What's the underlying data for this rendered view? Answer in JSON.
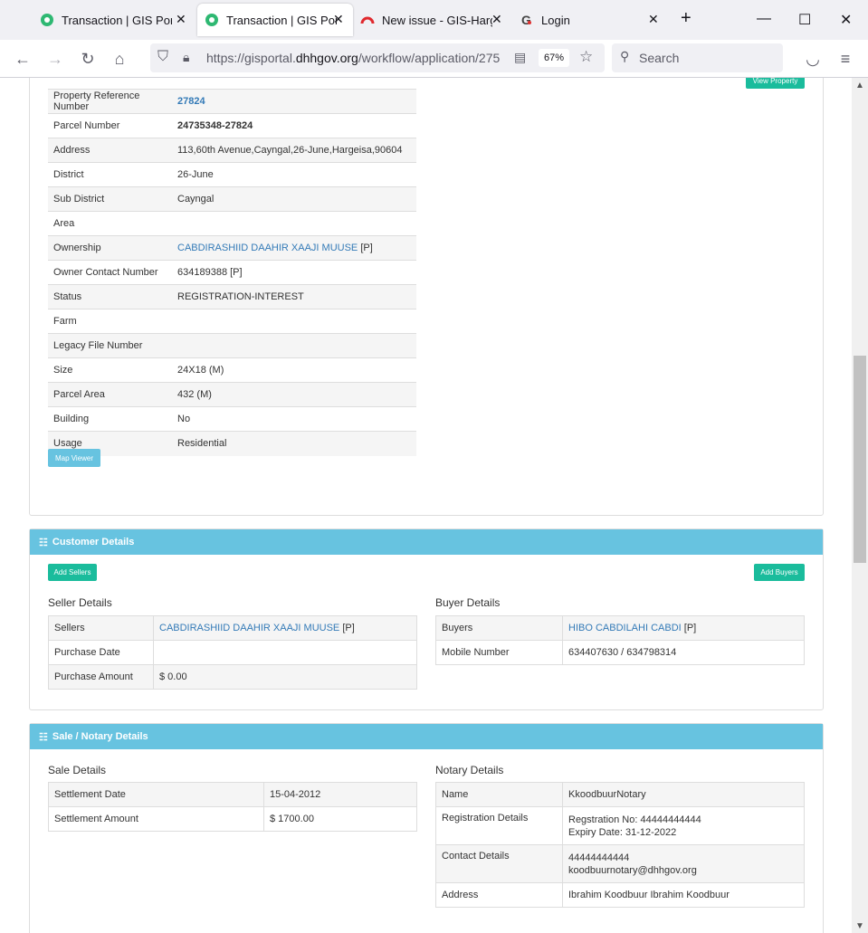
{
  "browser": {
    "tabs": [
      {
        "title": "Transaction | GIS Portal",
        "icon": "gis-portal-icon"
      },
      {
        "title": "Transaction | GIS Portal",
        "icon": "gis-portal-icon",
        "active": true
      },
      {
        "title": "New issue - GIS-Harge",
        "icon": "issue-tracker-icon"
      },
      {
        "title": "Login",
        "icon": "g-logo-icon"
      }
    ],
    "url_prefix": "https://gisportal.",
    "url_domain": "dhhgov.org",
    "url_path": "/workflow/application/275",
    "zoom": "67%",
    "search_placeholder": "Search"
  },
  "property": {
    "view_button": "View Property",
    "map_button": "Map Viewer",
    "rows": [
      {
        "label": "Property Reference Number",
        "value": "27824",
        "link": true,
        "bold": true
      },
      {
        "label": "Parcel Number",
        "value": "24735348-27824",
        "bold": true
      },
      {
        "label": "Address",
        "value": "113,60th Avenue,Cayngal,26-June,Hargeisa,90604"
      },
      {
        "label": "District",
        "value": "26-June"
      },
      {
        "label": "Sub District",
        "value": "Cayngal"
      },
      {
        "label": "Area",
        "value": ""
      },
      {
        "label": "Ownership",
        "value": "CABDIRASHIID DAAHIR XAAJI MUUSE",
        "link": true,
        "suffix": " [P]"
      },
      {
        "label": "Owner Contact Number",
        "value": "634189388 [P]"
      },
      {
        "label": "Status",
        "value": "REGISTRATION-INTEREST"
      },
      {
        "label": "Farm",
        "value": ""
      },
      {
        "label": "Legacy File Number",
        "value": ""
      },
      {
        "label": "Size",
        "value": "24X18 (M)"
      },
      {
        "label": "Parcel Area",
        "value": "432 (M)"
      },
      {
        "label": "Building",
        "value": "No"
      },
      {
        "label": "Usage",
        "value": "Residential"
      }
    ]
  },
  "customer": {
    "title": "Customer Details",
    "add_sellers": "Add Sellers",
    "add_buyers": "Add Buyers",
    "seller_title": "Seller Details",
    "buyer_title": "Buyer Details",
    "sellers": [
      {
        "label": "Sellers",
        "value": "CABDIRASHIID DAAHIR XAAJI MUUSE",
        "link": true,
        "suffix": " [P]"
      },
      {
        "label": "Purchase Date",
        "value": ""
      },
      {
        "label": "Purchase Amount",
        "value": "$ 0.00"
      }
    ],
    "buyers": [
      {
        "label": "Buyers",
        "value": "HIBO CABDILAHI CABDI",
        "link": true,
        "suffix": " [P]"
      },
      {
        "label": "Mobile Number",
        "value": "634407630 / 634798314"
      }
    ]
  },
  "sale": {
    "title": "Sale / Notary Details",
    "sale_title": "Sale Details",
    "notary_title": "Notary Details",
    "sale_rows": [
      {
        "label": "Settlement Date",
        "value": "15-04-2012"
      },
      {
        "label": "Settlement Amount",
        "value": "$ 1700.00"
      }
    ],
    "notary_rows": [
      {
        "label": "Name",
        "value": "KkoodbuurNotary"
      },
      {
        "label": "Registration Details",
        "line1": "Regstration No: 44444444444",
        "line2": "Expiry Date: 31-12-2022"
      },
      {
        "label": "Contact Details",
        "line1": "44444444444",
        "line2": "koodbuurnotary@dhhgov.org"
      },
      {
        "label": "Address",
        "value": "Ibrahim Koodbuur Ibrahim Koodbuur"
      }
    ]
  },
  "colors": {
    "heading": "#67c3e0",
    "green_button": "#1abc9c",
    "link": "#337ab7"
  }
}
